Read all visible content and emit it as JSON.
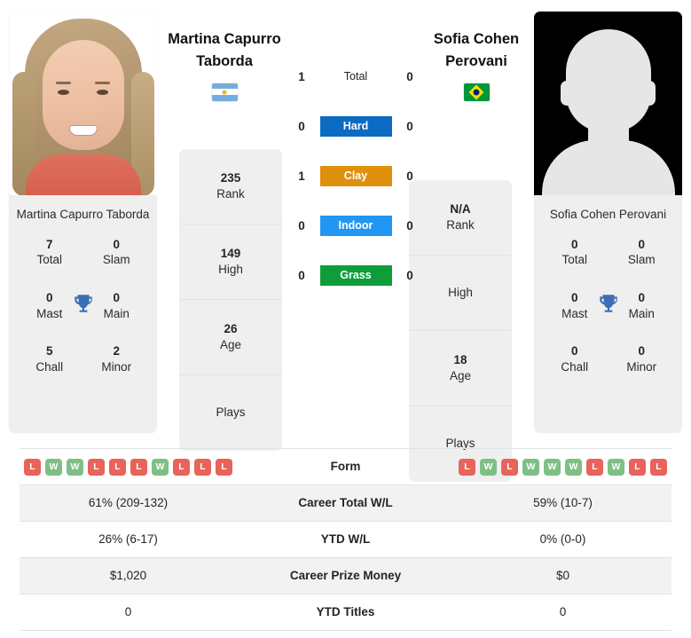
{
  "players": {
    "left": {
      "name": "Martina Capurro Taborda",
      "name_line1": "Martina Capurro",
      "name_line2": "Taborda",
      "card_name": "Martina Capurro Taborda",
      "flag": "argentina-flag",
      "photo": "player-photo",
      "stats": [
        {
          "value": "235",
          "label": "Rank"
        },
        {
          "value": "149",
          "label": "High"
        },
        {
          "value": "26",
          "label": "Age"
        },
        {
          "value": "",
          "label": "Plays"
        }
      ],
      "titles": [
        {
          "value": "7",
          "label": "Total"
        },
        {
          "value": "0",
          "label": "Slam"
        },
        {
          "value": "0",
          "label": "Mast"
        },
        {
          "value": "0",
          "label": "Main"
        },
        {
          "value": "5",
          "label": "Chall"
        },
        {
          "value": "2",
          "label": "Minor"
        }
      ],
      "form": [
        "L",
        "W",
        "W",
        "L",
        "L",
        "L",
        "W",
        "L",
        "L",
        "L"
      ],
      "career_total_wl": "61% (209-132)",
      "ytd_wl": "26% (6-17)",
      "career_prize_money": "$1,020",
      "ytd_titles": "0"
    },
    "right": {
      "name": "Sofia Cohen Perovani",
      "name_line1": "Sofia Cohen",
      "name_line2": "Perovani",
      "card_name": "Sofia Cohen Perovani",
      "flag": "brazil-flag",
      "photo": "player-photo-placeholder",
      "stats": [
        {
          "value": "N/A",
          "label": "Rank"
        },
        {
          "value": "",
          "label": "High"
        },
        {
          "value": "18",
          "label": "Age"
        },
        {
          "value": "",
          "label": "Plays"
        }
      ],
      "titles": [
        {
          "value": "0",
          "label": "Total"
        },
        {
          "value": "0",
          "label": "Slam"
        },
        {
          "value": "0",
          "label": "Mast"
        },
        {
          "value": "0",
          "label": "Main"
        },
        {
          "value": "0",
          "label": "Chall"
        },
        {
          "value": "0",
          "label": "Minor"
        }
      ],
      "form": [
        "L",
        "W",
        "L",
        "W",
        "W",
        "W",
        "L",
        "W",
        "L",
        "L"
      ],
      "career_total_wl": "59% (10-7)",
      "ytd_wl": "0% (0-0)",
      "career_prize_money": "$0",
      "ytd_titles": "0"
    }
  },
  "surfaces": [
    {
      "label": "Total",
      "left": "1",
      "right": "0",
      "color": "",
      "plain": true
    },
    {
      "label": "Hard",
      "left": "0",
      "right": "0",
      "color": "#0b6bc2",
      "plain": false
    },
    {
      "label": "Clay",
      "left": "1",
      "right": "0",
      "color": "#df900c",
      "plain": false
    },
    {
      "label": "Indoor",
      "left": "0",
      "right": "0",
      "color": "#2196f3",
      "plain": false
    },
    {
      "label": "Grass",
      "left": "0",
      "right": "0",
      "color": "#0f9d3c",
      "plain": false
    }
  ],
  "table": {
    "rows": [
      {
        "label": "Form",
        "type": "form"
      },
      {
        "label": "Career Total W/L",
        "type": "text",
        "key": "career_total_wl"
      },
      {
        "label": "YTD W/L",
        "type": "text",
        "key": "ytd_wl"
      },
      {
        "label": "Career Prize Money",
        "type": "text",
        "key": "career_prize_money"
      },
      {
        "label": "YTD Titles",
        "type": "text",
        "key": "ytd_titles"
      }
    ]
  },
  "colors": {
    "win_badge": "#7fbf85",
    "loss_badge": "#e8635a",
    "card_bg": "#efefef",
    "row_shade": "#f2f2f2",
    "trophy": "#3b6fb5"
  },
  "trophy_icon": "trophy-icon"
}
